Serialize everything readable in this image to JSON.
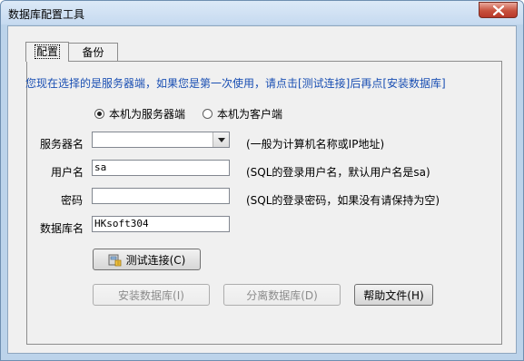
{
  "window": {
    "title": "数据库配置工具",
    "close_icon": "close-icon"
  },
  "tabs": [
    {
      "label": "配置",
      "active": true
    },
    {
      "label": "备份",
      "active": false
    }
  ],
  "info_text": "您现在选择的是服务器端，如果您是第一次使用，请点击[测试连接]后再点[安装数据库]",
  "mode": {
    "server_label": "本机为服务器端",
    "client_label": "本机为客户端",
    "selected": "server"
  },
  "form": {
    "server": {
      "label": "服务器名",
      "value": "",
      "hint": "(一般为计算机名称或IP地址)"
    },
    "user": {
      "label": "用户名",
      "value": "sa",
      "hint": "(SQL的登录用户名，默认用户名是sa)"
    },
    "password": {
      "label": "密码",
      "value": "",
      "hint": "(SQL的登录密码，如果没有请保持为空)"
    },
    "database": {
      "label": "数据库名",
      "value": "HKsoft304"
    }
  },
  "buttons": {
    "test": "测试连接(C)",
    "install": "安装数据库(I)",
    "detach": "分离数据库(D)",
    "help": "帮助文件(H)"
  },
  "colors": {
    "info_text": "#1a4fb3",
    "frame": "#bcd3ea",
    "close_button": "#c8513d"
  }
}
